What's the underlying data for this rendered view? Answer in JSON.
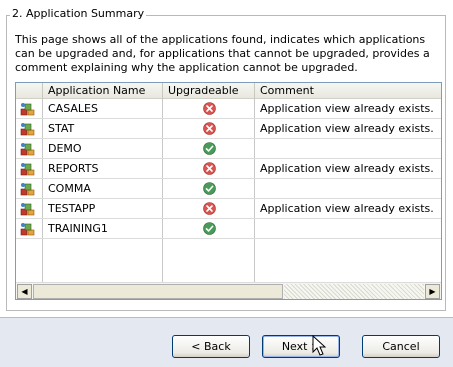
{
  "section": {
    "title": "2. Application Summary",
    "description": "This page shows all of the applications found, indicates which applications can be upgraded and, for applications that cannot be upgraded, provides a comment explaining why the application cannot be upgraded."
  },
  "grid": {
    "columns": [
      "Application Name",
      "Upgradeable",
      "Comment"
    ],
    "rows": [
      {
        "name": "CASALES",
        "upgradeable": "no",
        "comment": "Application view already exists."
      },
      {
        "name": "STAT",
        "upgradeable": "no",
        "comment": "Application view already exists."
      },
      {
        "name": "DEMO",
        "upgradeable": "yes",
        "comment": ""
      },
      {
        "name": "REPORTS",
        "upgradeable": "no",
        "comment": "Application view already exists."
      },
      {
        "name": "COMMA",
        "upgradeable": "yes",
        "comment": ""
      },
      {
        "name": "TESTAPP",
        "upgradeable": "no",
        "comment": "Application view already exists."
      },
      {
        "name": "TRAINING1",
        "upgradeable": "yes",
        "comment": ""
      }
    ]
  },
  "scrollbar": {
    "left_icon": "scroll-left-arrow-icon",
    "right_icon": "scroll-right-arrow-icon"
  },
  "buttons": {
    "back": "< Back",
    "next": "Next >",
    "cancel": "Cancel"
  },
  "colors": {
    "error": "#d9534f",
    "ok": "#4a9a5a",
    "footer_bg": "#e4e8f0"
  }
}
